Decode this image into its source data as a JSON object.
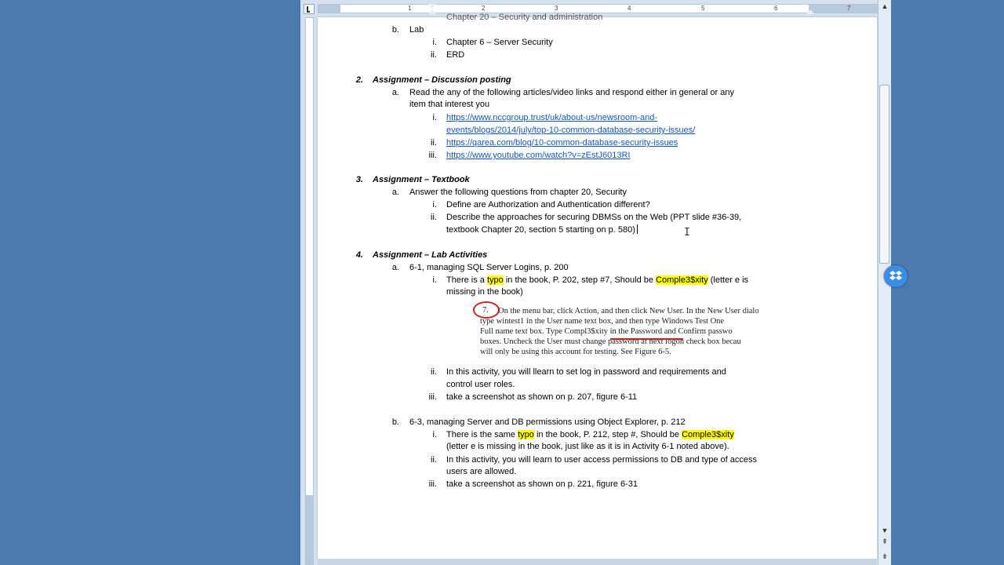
{
  "ruler": {
    "numbers": [
      "1",
      "2",
      "3",
      "4",
      "5",
      "6",
      "7"
    ]
  },
  "document": {
    "top_cut_line": "Chapter 20 – Security and administration",
    "lab": {
      "marker": "b.",
      "label": "Lab"
    },
    "lab_items": [
      {
        "marker": "i.",
        "text": "Chapter 6 – Server Security"
      },
      {
        "marker": "ii.",
        "text": "ERD"
      }
    ],
    "assign2": {
      "num": "2.",
      "heading": "Assignment – Discussion posting",
      "a_marker": "a.",
      "a_line1": "Read the any of the following articles/video links and respond either in general or any",
      "a_line2": "item that interest you",
      "links": [
        {
          "marker": "i.",
          "line1": "https://www.nccgroup.trust/uk/about-us/newsroom-and-",
          "line2": "events/blogs/2014/july/top-10-common-database-security-issues/"
        },
        {
          "marker": "ii.",
          "line1": "https://qarea.com/blog/10-common-database-security-issues"
        },
        {
          "marker": "iii.",
          "line1": "https://www.youtube.com/watch?v=zEstJ6013RI"
        }
      ]
    },
    "assign3": {
      "num": "3.",
      "heading": "Assignment – Textbook",
      "a_marker": "a.",
      "a_text": "Answer the following questions from chapter 20, Security",
      "items": [
        {
          "marker": "i.",
          "line1": "Define are Authorization and Authentication different?"
        },
        {
          "marker": "ii.",
          "line1": "Describe the approaches for securing DBMSs on the Web (PPT slide #36-39,",
          "line2": "textbook Chapter 20, section 5 starting on p. 580)"
        }
      ]
    },
    "assign4": {
      "num": "4.",
      "heading": "Assignment – Lab Activities",
      "a_marker": "a.",
      "a_text": "6-1, managing SQL Server Logins, p. 200",
      "a_i": {
        "marker": "i.",
        "pre": "There is a ",
        "typo": "typo",
        "mid": " in the book, P. 202, step #7, Should be ",
        "word": "Comple3$xity",
        "post": " (letter e is",
        "line2": "missing in the book)"
      },
      "excerpt": {
        "step": "7.",
        "lines": [
          "On the menu bar, click Action, and then click New User. In the New User dialo",
          "type wintest1 in the User name text box, and then type Windows Test One",
          "Full name text box. Type Compl3$xity in the Password and Confirm passwo",
          "boxes. Uncheck the User must change password at next logon check box becau",
          "will only be using this account for testing. See Figure 6-5."
        ]
      },
      "a_ii": {
        "marker": "ii.",
        "line1": "In this activity, you will llearn to set log in password and requirements and",
        "line2": "control user roles."
      },
      "a_iii": {
        "marker": "iii.",
        "line1": "take a screenshot as shown on p. 207, figure 6-11"
      },
      "b_marker": "b.",
      "b_text": "6-3, managing Server and DB permissions using Object Explorer, p. 212",
      "b_i": {
        "marker": "i.",
        "pre": "There is the same ",
        "typo": "typo",
        "mid": " in the book, P. 212, step #, Should be ",
        "word": "Comple3$xity",
        "line2": "(letter e is missing in the book, just like as it is in Activity 6-1 noted above)."
      },
      "b_ii": {
        "marker": "ii.",
        "line1": "In this activity, you will learn to user access permissions to DB and type of access",
        "line2": "users are allowed."
      },
      "b_iii": {
        "marker": "iii.",
        "line1": "take a screenshot as shown on p. 221, figure 6-31"
      }
    }
  },
  "colors": {
    "link": "#1155cc",
    "highlight": "#ffff00",
    "annotation": "#d42020",
    "desktop": "#4c7aaf"
  }
}
